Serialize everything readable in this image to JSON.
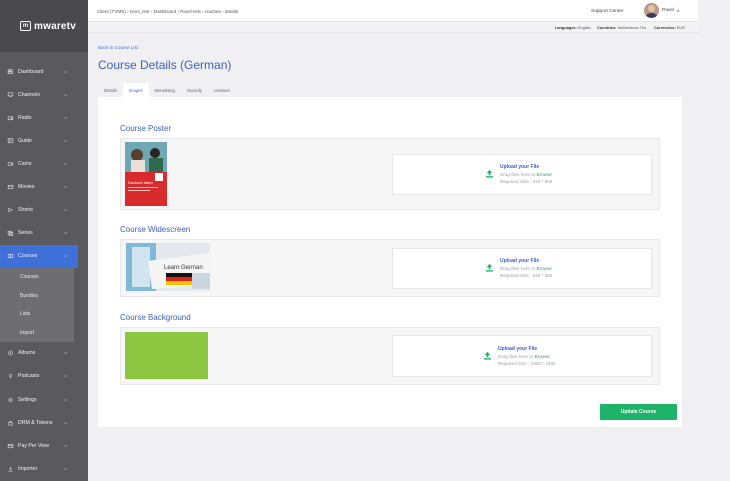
{
  "brand": {
    "logo_text": "mwaretv"
  },
  "sidebar": {
    "items": [
      {
        "label": "Dashboard",
        "icon": "dashboard-icon"
      },
      {
        "label": "Channels",
        "icon": "tv-icon"
      },
      {
        "label": "Radio",
        "icon": "radio-icon"
      },
      {
        "label": "Guide",
        "icon": "guide-icon"
      },
      {
        "label": "Cams",
        "icon": "camera-icon"
      },
      {
        "label": "Movies",
        "icon": "movie-icon"
      },
      {
        "label": "Shorts",
        "icon": "shorts-icon"
      },
      {
        "label": "Series",
        "icon": "series-icon"
      },
      {
        "label": "Courses",
        "icon": "courses-icon",
        "active": true
      },
      {
        "label": "Albums",
        "icon": "album-icon"
      },
      {
        "label": "Podcasts",
        "icon": "podcast-icon"
      },
      {
        "label": "Settings",
        "icon": "settings-icon"
      },
      {
        "label": "DRM & Tokens",
        "icon": "drm-icon"
      },
      {
        "label": "Pay Per View",
        "icon": "pay-per-view-icon"
      },
      {
        "label": "Importer",
        "icon": "importer-icon"
      }
    ],
    "courses_sub": [
      "Courses",
      "Bundles",
      "Lists",
      "Import"
    ]
  },
  "topbar": {
    "breadcrumb": "Client (TVMS)  ›  tvms_test  ›  Dashboard  ›  Pavel-test › courses › details",
    "support": "Support Center",
    "username": "Pavel"
  },
  "infobar": {
    "languages_label": "Languages:",
    "languages_value": "English",
    "countries_label": "Countries:",
    "countries_value": "Netherlands The",
    "currencies_label": "Currencies:",
    "currencies_value": "EUR"
  },
  "page": {
    "back_link": "Back to Course List",
    "title": "Course Details (German)",
    "tabs": [
      "Details",
      "Images",
      "Monetising",
      "Security",
      "Lessons"
    ],
    "active_tab": "Images"
  },
  "sections": [
    {
      "title": "Course Poster",
      "upload_title": "Upload your File",
      "drag_text": "Drag files here or ",
      "browse": "Browse",
      "required": "Required Size : 340 * 500"
    },
    {
      "title": "Course Widescreen",
      "upload_title": "Upload your File",
      "drag_text": "Drag files here or ",
      "browse": "Browse",
      "required": "Required Size : 640 * 360"
    },
    {
      "title": "Course Background",
      "upload_title": "Upload your File",
      "drag_text": "Drag files here or ",
      "browse": "Browse",
      "required": "Required Size : 1920 * 1080"
    }
  ],
  "poster_text": {
    "title": "Deutsch üben"
  },
  "widescreen_text": {
    "caption": "Learn German"
  },
  "update_button": "Update Course",
  "colors": {
    "accent": "#3f6fd8",
    "green": "#1db46a",
    "background_thumb": "#8cc540"
  }
}
